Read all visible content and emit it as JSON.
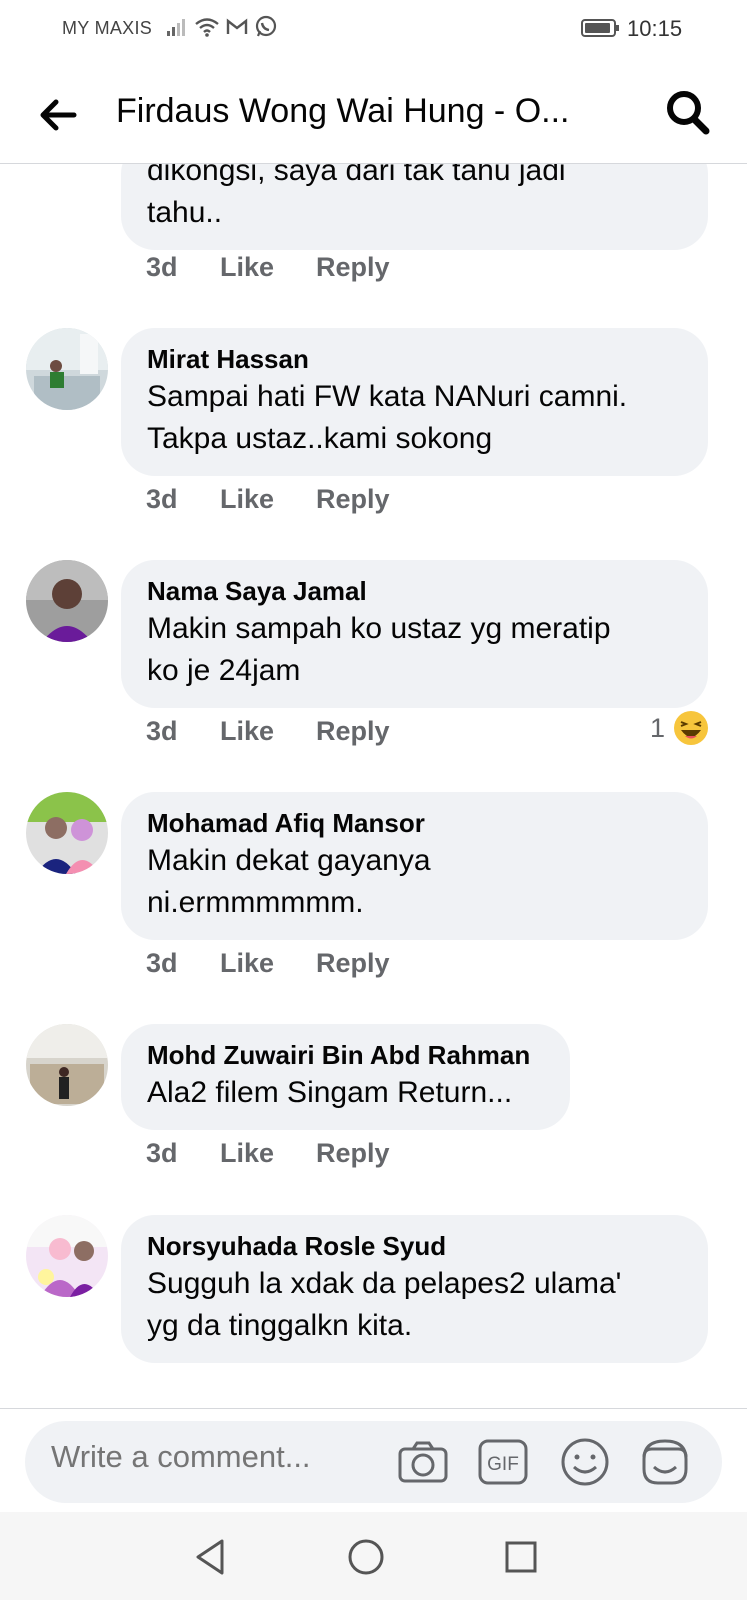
{
  "status_bar": {
    "carrier": "MY MAXIS",
    "time": "10:15"
  },
  "header": {
    "title": "Firdaus Wong Wai Hung - O..."
  },
  "top_comment": {
    "text_lines": [
      "dikongsi, saya dari tak tahu jadi",
      "tahu.."
    ],
    "time": "3d",
    "like": "Like",
    "reply": "Reply"
  },
  "comments": [
    {
      "author": "Mirat Hassan",
      "text_lines": [
        "Sampai hati FW kata NANuri camni.",
        "Takpa ustaz..kami sokong"
      ],
      "time": "3d",
      "like": "Like",
      "reply": "Reply"
    },
    {
      "author": "Nama Saya Jamal",
      "text_lines": [
        "Makin sampah ko ustaz yg meratip",
        "ko je 24jam"
      ],
      "time": "3d",
      "like": "Like",
      "reply": "Reply",
      "reaction_count": "1",
      "reaction_icon": "laughing-emoji-icon"
    },
    {
      "author": "Mohamad Afiq Mansor",
      "text_lines": [
        "Makin dekat gayanya",
        "ni.ermmmmmm."
      ],
      "time": "3d",
      "like": "Like",
      "reply": "Reply"
    },
    {
      "author": "Mohd Zuwairi Bin Abd Rahman",
      "text_lines": [
        "Ala2 filem Singam Return..."
      ],
      "time": "3d",
      "like": "Like",
      "reply": "Reply"
    },
    {
      "author": "Norsyuhada Rosle Syud",
      "text_lines": [
        "Sugguh la xdak da pelapes2 ulama'",
        "yg da tinggalkn kita."
      ]
    }
  ],
  "composer": {
    "placeholder": "Write a comment...",
    "icons": [
      "camera-icon",
      "gif-icon",
      "emoji-icon",
      "sticker-icon"
    ]
  },
  "nav_bar": {
    "icons": [
      "back-triangle-icon",
      "home-circle-icon",
      "recents-square-icon"
    ]
  },
  "colors": {
    "bubble": "#f0f2f5",
    "secondary_text": "#65676b",
    "divider": "#d6d8dc"
  }
}
